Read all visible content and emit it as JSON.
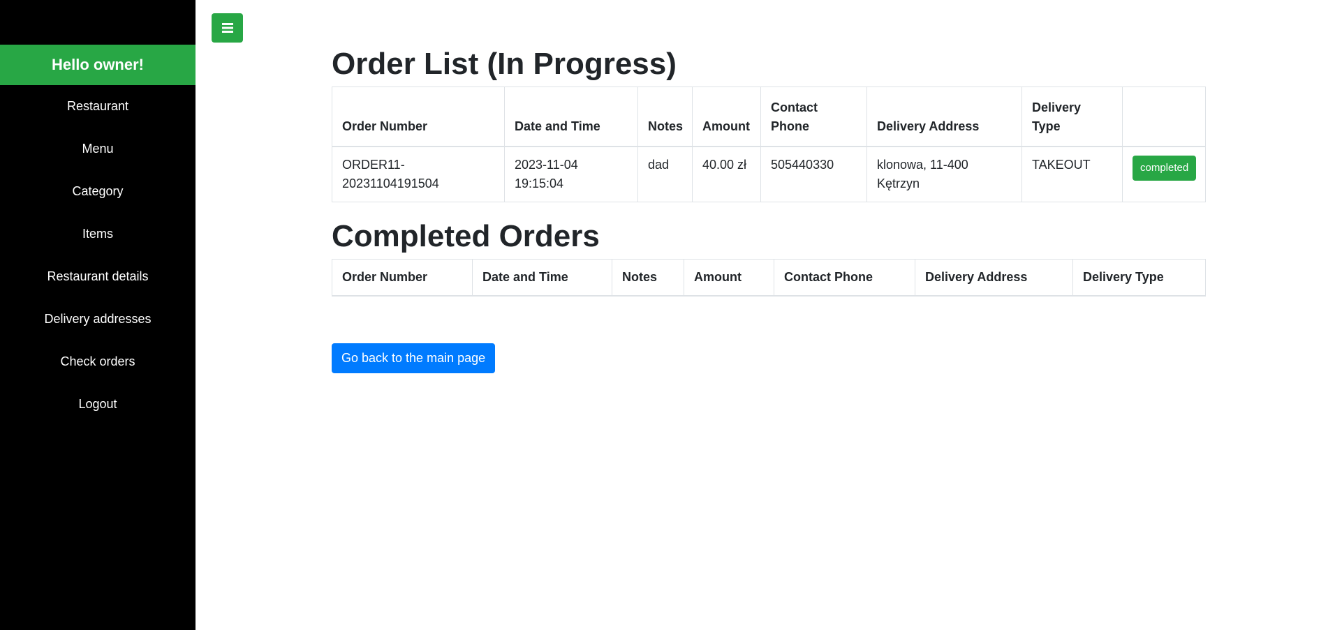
{
  "sidebar": {
    "greeting": "Hello owner!",
    "items": [
      {
        "label": "Restaurant"
      },
      {
        "label": "Menu"
      },
      {
        "label": "Category"
      },
      {
        "label": "Items"
      },
      {
        "label": "Restaurant details"
      },
      {
        "label": "Delivery addresses"
      },
      {
        "label": "Check orders"
      },
      {
        "label": "Logout"
      }
    ]
  },
  "toolbar": {
    "toggle_icon": "hamburger-icon"
  },
  "in_progress": {
    "title": "Order List (In Progress)",
    "headers": [
      "Order Number",
      "Date and Time",
      "Notes",
      "Amount",
      "Contact Phone",
      "Delivery Address",
      "Delivery Type",
      ""
    ],
    "rows": [
      {
        "order_number": "ORDER11-20231104191504",
        "date_time": "2023-11-04 19:15:04",
        "notes": "dad",
        "amount": "40.00 zł",
        "phone": "505440330",
        "address": "klonowa, 11-400 Kętrzyn",
        "delivery_type": "TAKEOUT",
        "action_label": "completed"
      }
    ]
  },
  "completed": {
    "title": "Completed Orders",
    "headers": [
      "Order Number",
      "Date and Time",
      "Notes",
      "Amount",
      "Contact Phone",
      "Delivery Address",
      "Delivery Type"
    ]
  },
  "back_button": "Go back to the main page",
  "colors": {
    "accent_green": "#28a745",
    "primary_blue": "#007bff",
    "sidebar_bg": "#000000"
  }
}
